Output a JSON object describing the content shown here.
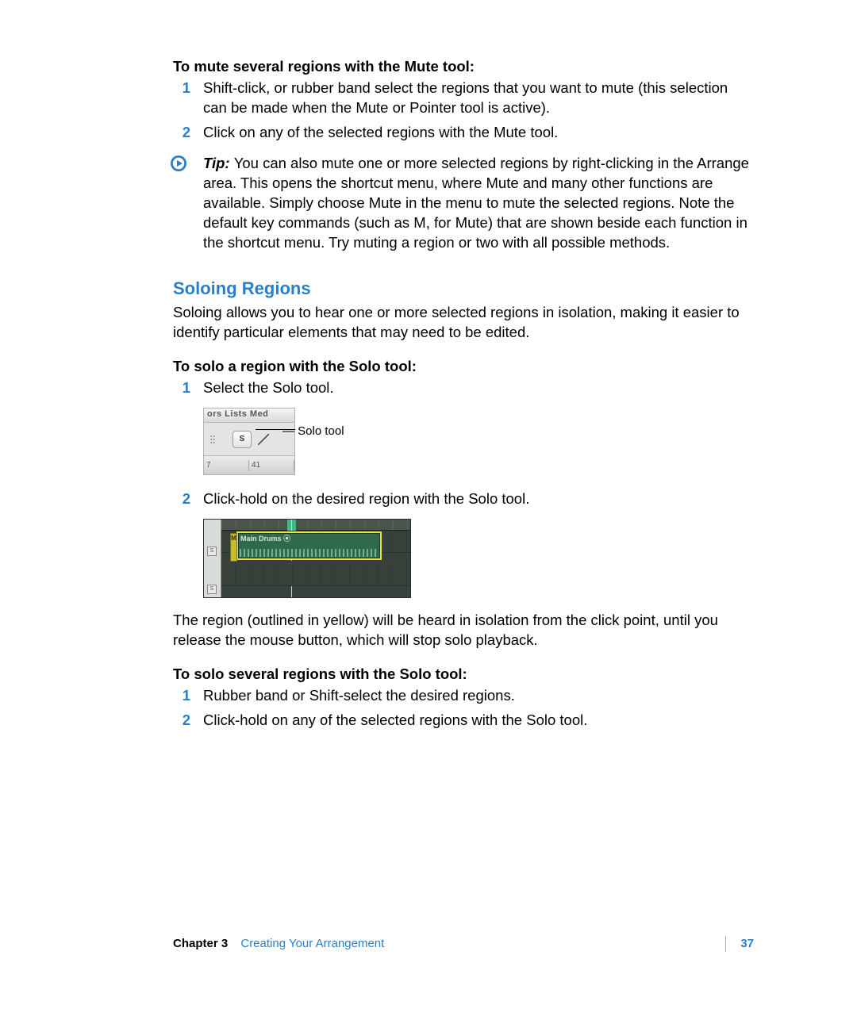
{
  "mute_section": {
    "heading": "To mute several regions with the Mute tool:",
    "steps": [
      "Shift-click, or rubber band select the regions that you want to mute (this selection can be made when the Mute or Pointer tool is active).",
      "Click on any of the selected regions with the Mute tool."
    ]
  },
  "tip": {
    "label": "Tip:",
    "text": "You can also mute one or more selected regions by right-clicking in the Arrange area. This opens the shortcut menu, where Mute and many other functions are available. Simply choose Mute in the menu to mute the selected regions. Note the default key commands (such as M, for Mute) that are shown beside each function in the shortcut menu. Try muting a region or two with all possible methods."
  },
  "solo_section": {
    "title": "Soloing Regions",
    "intro": "Soloing allows you to hear one or more selected regions in isolation, making it easier to identify particular elements that may need to be edited.",
    "sub1_heading": "To solo a region with the Solo tool:",
    "sub1_steps": [
      "Select the Solo tool.",
      "Click-hold on the desired region with the Solo tool."
    ],
    "followup": "The region (outlined in yellow) will be heard in isolation from the click point, until you release the mouse button, which will stop solo playback.",
    "sub2_heading": "To solo several regions with the Solo tool:",
    "sub2_steps": [
      "Rubber band or Shift-select the desired regions.",
      "Click-hold on any of the selected regions with the Solo tool."
    ]
  },
  "screenshot1": {
    "menu_items": "ors   Lists   Med",
    "tool_label": "S",
    "ruler_a": "7",
    "ruler_b": "41",
    "callout": "Solo tool"
  },
  "screenshot2": {
    "region_name": "Main Drums ⦿",
    "m_badge": "M",
    "s_btn": "S"
  },
  "footer": {
    "chapter": "Chapter 3",
    "title": "Creating Your Arrangement",
    "page": "37"
  }
}
